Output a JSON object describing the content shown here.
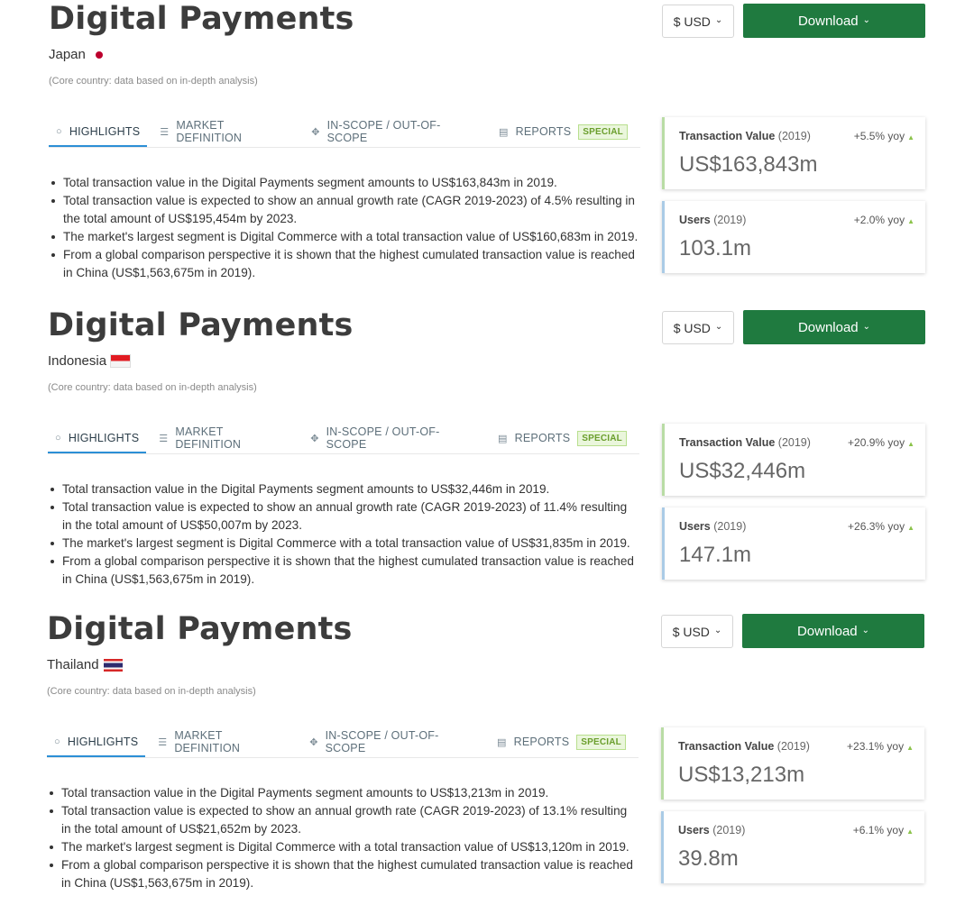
{
  "sections": [
    {
      "title": "Digital Payments",
      "country": "Japan",
      "flag": "japan-flag",
      "core_note": "(Core country: data based on in-depth analysis)",
      "currency": "$ USD",
      "download": "Download",
      "tabs": [
        "HIGHLIGHTS",
        "MARKET DEFINITION",
        "IN-SCOPE / OUT-OF-SCOPE",
        "REPORTS"
      ],
      "special_badge": "SPECIAL",
      "highlights": [
        "Total transaction value in the Digital Payments segment amounts to US$163,843m in 2019.",
        "Total transaction value is expected to show an annual growth rate (CAGR 2019-2023) of 4.5% resulting in the total amount of US$195,454m by 2023.",
        "The market's largest segment is Digital Commerce with a total transaction value of US$160,683m in 2019.",
        "From a global comparison perspective it is shown that the highest cumulated transaction value is reached in China (US$1,563,675m in 2019)."
      ],
      "kpis": {
        "transaction": {
          "label": "Transaction Value",
          "year": "(2019)",
          "yoy": "+5.5% yoy",
          "value": "US$163,843m"
        },
        "users": {
          "label": "Users",
          "year": "(2019)",
          "yoy": "+2.0% yoy",
          "value": "103.1m"
        }
      }
    },
    {
      "title": "Digital Payments",
      "country": "Indonesia",
      "flag": "indonesia-flag",
      "core_note": "(Core country: data based on in-depth analysis)",
      "currency": "$ USD",
      "download": "Download",
      "tabs": [
        "HIGHLIGHTS",
        "MARKET DEFINITION",
        "IN-SCOPE / OUT-OF-SCOPE",
        "REPORTS"
      ],
      "special_badge": "SPECIAL",
      "highlights": [
        "Total transaction value in the Digital Payments segment amounts to US$32,446m in 2019.",
        "Total transaction value is expected to show an annual growth rate (CAGR 2019-2023) of 11.4% resulting in the total amount of US$50,007m by 2023.",
        "The market's largest segment is Digital Commerce with a total transaction value of US$31,835m in 2019.",
        "From a global comparison perspective it is shown that the highest cumulated transaction value is reached in China (US$1,563,675m in 2019)."
      ],
      "kpis": {
        "transaction": {
          "label": "Transaction Value",
          "year": "(2019)",
          "yoy": "+20.9% yoy",
          "value": "US$32,446m"
        },
        "users": {
          "label": "Users",
          "year": "(2019)",
          "yoy": "+26.3% yoy",
          "value": "147.1m"
        }
      }
    },
    {
      "title": "Digital Payments",
      "country": "Thailand",
      "flag": "thailand-flag",
      "core_note": "(Core country: data based on in-depth analysis)",
      "currency": "$ USD",
      "download": "Download",
      "tabs": [
        "HIGHLIGHTS",
        "MARKET DEFINITION",
        "IN-SCOPE / OUT-OF-SCOPE",
        "REPORTS"
      ],
      "special_badge": "SPECIAL",
      "highlights": [
        "Total transaction value in the Digital Payments segment amounts to US$13,213m in 2019.",
        "Total transaction value is expected to show an annual growth rate (CAGR 2019-2023) of 13.1% resulting in the total amount of US$21,652m by 2023.",
        "The market's largest segment is Digital Commerce with a total transaction value of US$13,120m in 2019.",
        "From a global comparison perspective it is shown that the highest cumulated transaction value is reached in China (US$1,563,675m in 2019)."
      ],
      "kpis": {
        "transaction": {
          "label": "Transaction Value",
          "year": "(2019)",
          "yoy": "+23.1% yoy",
          "value": "US$13,213m"
        },
        "users": {
          "label": "Users",
          "year": "(2019)",
          "yoy": "+6.1% yoy",
          "value": "39.8m"
        }
      }
    }
  ]
}
